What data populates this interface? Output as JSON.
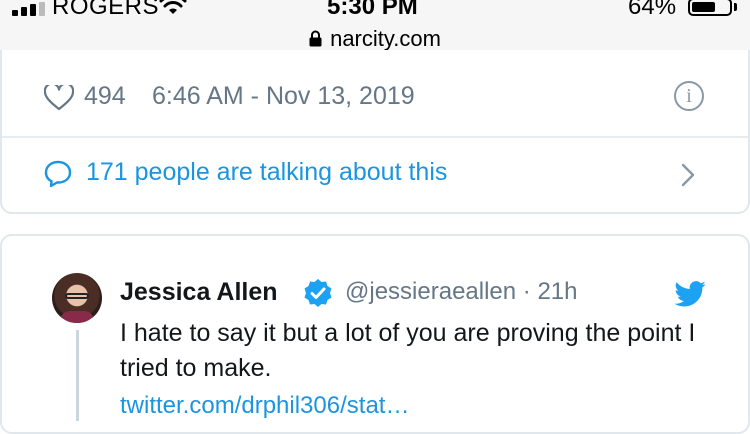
{
  "status_bar": {
    "carrier": "ROGERS",
    "time": "5:30 PM",
    "battery_percent": "64%",
    "battery_level": 0.64,
    "url": "narcity.com"
  },
  "tweet_stats": {
    "likes": "494",
    "datetime": "6:46 AM - Nov 13, 2019",
    "talking": "171 people are talking about this"
  },
  "reply": {
    "name": "Jessica Allen",
    "handle": "@jessieraeallen · 21h",
    "text": "I hate to say it but a lot of you are proving the point I tried to make.",
    "link": "twitter.com/drphil306/stat…"
  },
  "colors": {
    "accent": "#1b95e0",
    "muted": "#657786",
    "border": "#e1e8ed"
  },
  "icons": {
    "signal": "cellular-signal-icon",
    "wifi": "wifi-icon",
    "lock": "lock-icon",
    "like": "heart-icon",
    "info": "info-icon",
    "reply": "speech-bubble-icon",
    "more": "chevron-right-icon",
    "verified": "verified-badge-icon",
    "brand": "twitter-bird-icon"
  }
}
